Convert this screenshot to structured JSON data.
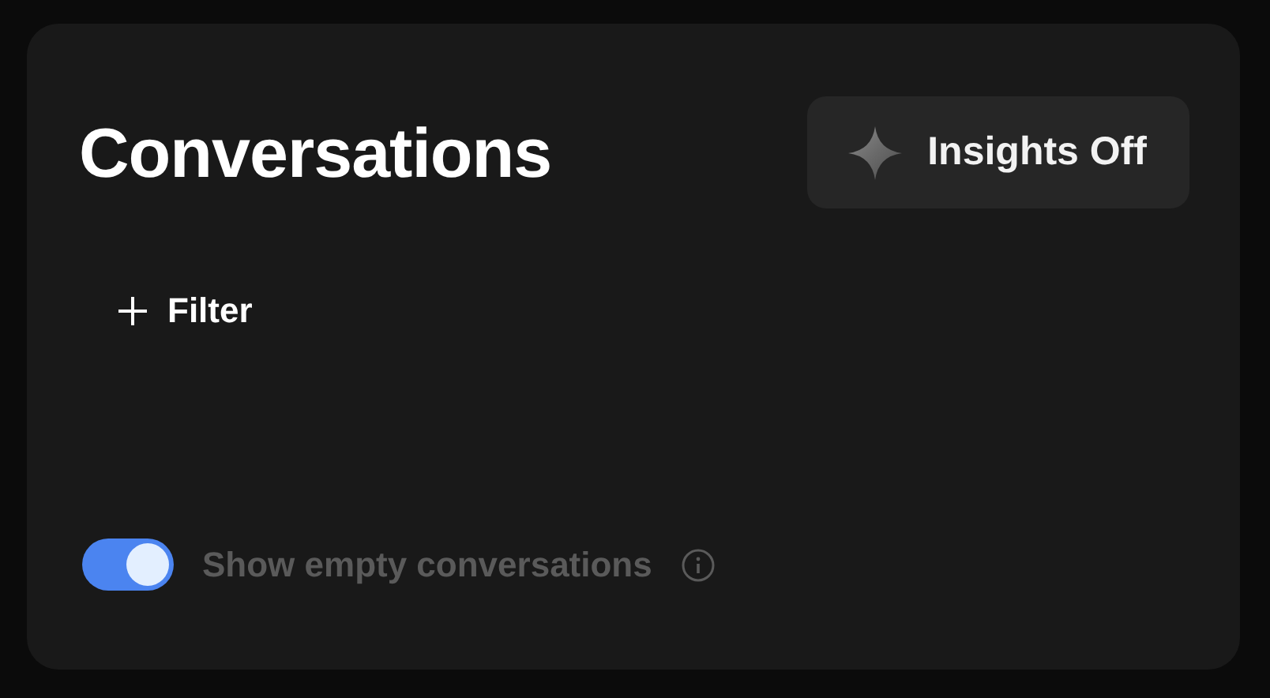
{
  "header": {
    "title": "Conversations",
    "insights_button": {
      "label": "Insights Off"
    }
  },
  "filter_button": {
    "label": "Filter"
  },
  "show_empty": {
    "label": "Show empty conversations",
    "on": true
  }
}
